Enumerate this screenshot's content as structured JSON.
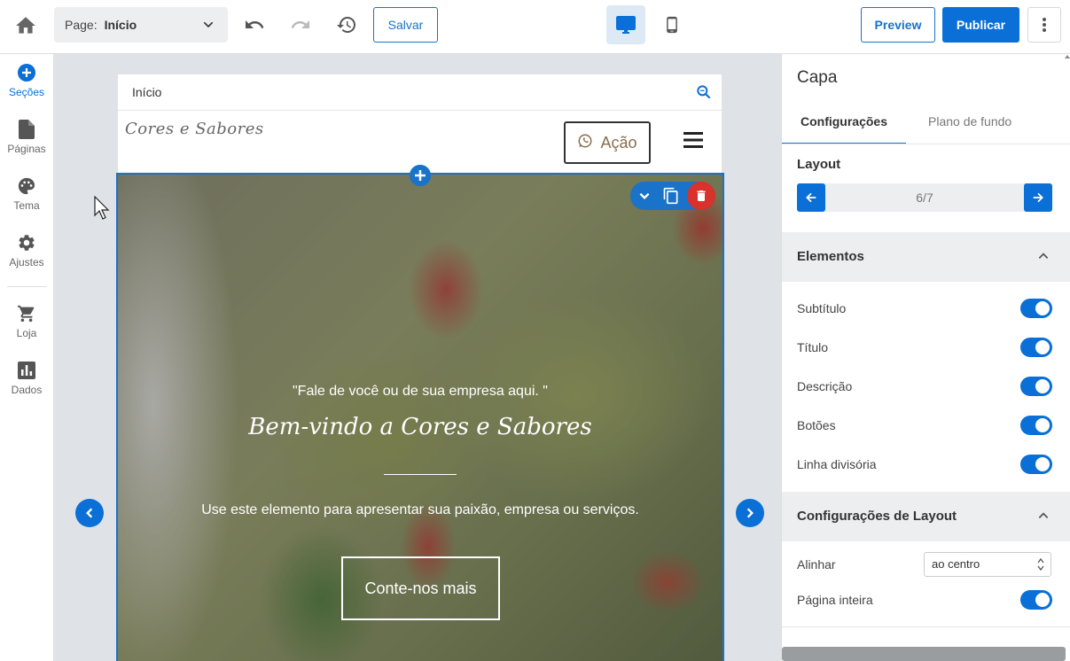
{
  "topbar": {
    "page_label": "Page:",
    "page_value": "Início",
    "save_label": "Salvar",
    "preview_label": "Preview",
    "publish_label": "Publicar"
  },
  "leftnav": {
    "items": [
      {
        "label": "Seções",
        "icon": "plus-circle-icon",
        "active": true
      },
      {
        "label": "Páginas",
        "icon": "page-icon",
        "active": false
      },
      {
        "label": "Tema",
        "icon": "palette-icon",
        "active": false
      },
      {
        "label": "Ajustes",
        "icon": "gear-icon",
        "active": false
      },
      {
        "label": "Loja",
        "icon": "cart-icon",
        "active": false
      },
      {
        "label": "Dados",
        "icon": "bar-chart-icon",
        "active": false
      }
    ]
  },
  "canvas": {
    "topbar_title": "Início",
    "logo_text": "Cores e Sabores",
    "action_label": "Ação",
    "hero": {
      "subtitle": "\"Fale de você ou de sua empresa aqui. \"",
      "title": "Bem-vindo a Cores e Sabores",
      "description": "Use este elemento para apresentar sua paixão, empresa ou serviços.",
      "button_label": "Conte-nos mais"
    }
  },
  "panel": {
    "title": "Capa",
    "tabs": [
      "Configurações",
      "Plano de fundo"
    ],
    "layout_label": "Layout",
    "layout_value": "6/7",
    "elements_title": "Elementos",
    "elements": [
      {
        "label": "Subtítulo",
        "on": true
      },
      {
        "label": "Título",
        "on": true
      },
      {
        "label": "Descrição",
        "on": true
      },
      {
        "label": "Botões",
        "on": true
      },
      {
        "label": "Linha divisória",
        "on": true
      }
    ],
    "layout_config_title": "Configurações de Layout",
    "align_label": "Alinhar",
    "align_value": "ao centro",
    "fullpage_label": "Página inteira",
    "fullpage_on": true
  },
  "colors": {
    "accent": "#0a6fd6",
    "delete": "#d9312b"
  }
}
